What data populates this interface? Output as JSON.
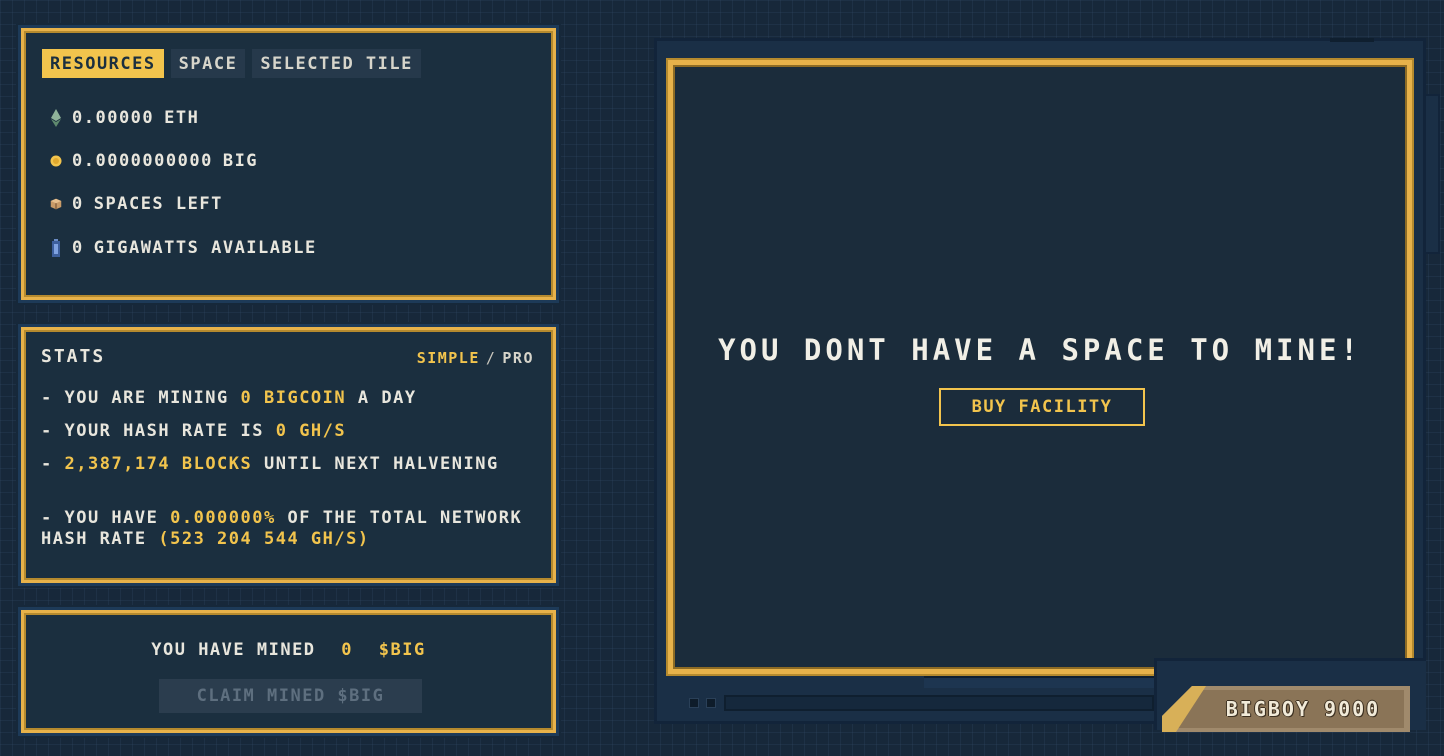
{
  "tabs": [
    {
      "label": "RESOURCES",
      "active": true
    },
    {
      "label": "SPACE",
      "active": false
    },
    {
      "label": "SELECTED TILE",
      "active": false
    }
  ],
  "resources": [
    {
      "icon": "eth-diamond-icon",
      "value": "0.00000",
      "unit": "ETH"
    },
    {
      "icon": "gold-coin-icon",
      "value": "0.0000000000",
      "unit": "BIG"
    },
    {
      "icon": "crate-box-icon",
      "value": "0",
      "unit": "SPACES LEFT"
    },
    {
      "icon": "battery-icon",
      "value": "0",
      "unit": "GIGAWATTS AVAILABLE"
    }
  ],
  "stats": {
    "title": "STATS",
    "mode_simple": "SIMPLE",
    "mode_separator": "/",
    "mode_pro": "PRO",
    "line1_prefix": "- YOU ARE MINING",
    "line1_value": "0 BIGCOIN",
    "line1_suffix": "A DAY",
    "line2_prefix": "- YOUR HASH RATE IS",
    "line2_value": "0 GH/S",
    "line3_prefix": "-",
    "line3_value": "2,387,174 BLOCKS",
    "line3_suffix": "UNTIL NEXT HALVENING",
    "line4_prefix": "- YOU HAVE",
    "line4_value": "0.000000%",
    "line4_suffix": "OF THE TOTAL NETWORK HASH RATE",
    "line4_value2": "(523 204 544 GH/S)"
  },
  "mined": {
    "label": "YOU HAVE MINED",
    "amount": "0",
    "currency": "$BIG",
    "claim_label": "CLAIM MINED $BIG"
  },
  "screen": {
    "message": "YOU DONT HAVE A SPACE TO MINE!",
    "buy_label": "BUY FACILITY"
  },
  "brand": "BIGBOY 9000",
  "colors": {
    "accent_gold": "#f2c44d",
    "panel_bg": "#1b2f3f",
    "page_bg": "#17283a"
  }
}
